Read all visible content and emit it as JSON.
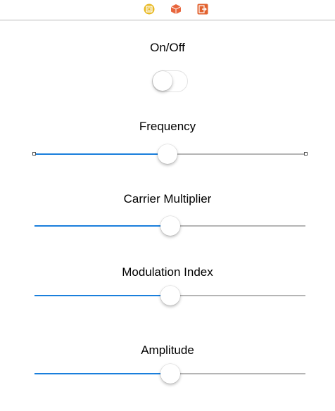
{
  "dock": {
    "icons": [
      "view-controller-icon",
      "first-responder-icon",
      "exit-icon"
    ],
    "colors": {
      "view_controller": "#e8b923",
      "first_responder": "#e8663d",
      "exit": "#e2622f"
    }
  },
  "controls": {
    "onoff": {
      "label": "On/Off",
      "on": false
    },
    "frequency": {
      "label": "Frequency",
      "value": 0.49
    },
    "carrier_multiplier": {
      "label": "Carrier Multiplier",
      "value": 0.5
    },
    "modulation_index": {
      "label": "Modulation Index",
      "value": 0.5
    },
    "amplitude": {
      "label": "Amplitude",
      "value": 0.5
    }
  },
  "colors": {
    "slider_min_track": "#1a7fdc",
    "slider_max_track": "#b5b5b5"
  }
}
